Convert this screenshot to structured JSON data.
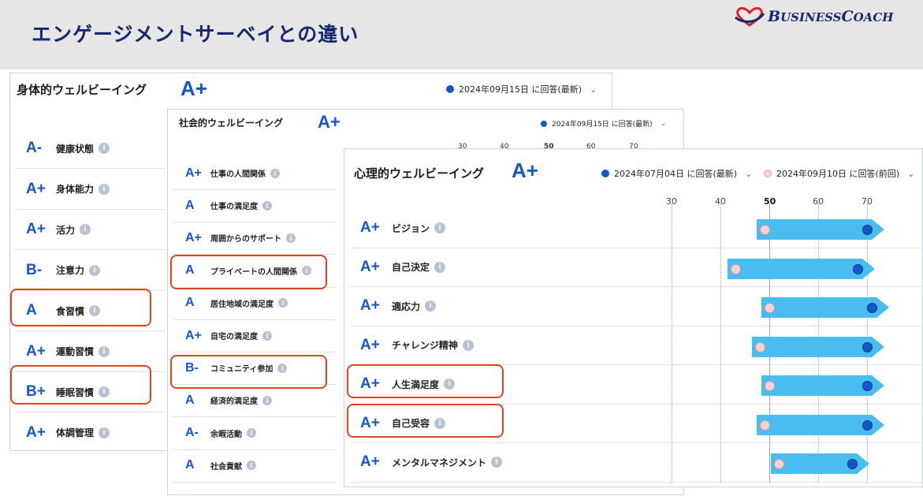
{
  "slide": {
    "title": "エンゲージメントサーベイとの違い",
    "logo_text_b": "B",
    "logo_text_rest1": "USINESS",
    "logo_text_c": "C",
    "logo_text_rest2": "OACH"
  },
  "physical": {
    "title": "身体的ウェルビーイング",
    "overall_grade": "A+",
    "selector": "2024年09月15日 に回答(最新)",
    "items": [
      {
        "grade": "A-",
        "label": "健康状態"
      },
      {
        "grade": "A+",
        "label": "身体能力"
      },
      {
        "grade": "A+",
        "label": "活力"
      },
      {
        "grade": "B-",
        "label": "注意力"
      },
      {
        "grade": "A",
        "label": "食習慣"
      },
      {
        "grade": "A+",
        "label": "運動習慣"
      },
      {
        "grade": "B+",
        "label": "睡眠習慣"
      },
      {
        "grade": "A+",
        "label": "体調管理"
      }
    ]
  },
  "social": {
    "title": "社会的ウェルビーイング",
    "overall_grade": "A+",
    "selector": "2024年09月15日 に回答(最新)",
    "axis": [
      "30",
      "40",
      "50",
      "60",
      "70"
    ],
    "items": [
      {
        "grade": "A+",
        "label": "仕事の人間関係"
      },
      {
        "grade": "A",
        "label": "仕事の満足度"
      },
      {
        "grade": "A+",
        "label": "周囲からのサポート"
      },
      {
        "grade": "A",
        "label": "プライベートの人間関係"
      },
      {
        "grade": "A",
        "label": "居住地域の満足度"
      },
      {
        "grade": "A+",
        "label": "自宅の満足度"
      },
      {
        "grade": "B-",
        "label": "コミュニティ参加"
      },
      {
        "grade": "A",
        "label": "経済的満足度"
      },
      {
        "grade": "A-",
        "label": "余暇活動"
      },
      {
        "grade": "A",
        "label": "社会貢献"
      }
    ]
  },
  "psychological": {
    "title": "心理的ウェルビーイング",
    "overall_grade": "A+",
    "selector_latest": "2024年07月04日 に回答(最新)",
    "selector_previous": "2024年09月10日 に回答(前回)",
    "axis": [
      "30",
      "40",
      "50",
      "60",
      "70"
    ],
    "items": [
      {
        "grade": "A+",
        "label": "ビジョン",
        "previous": 49,
        "latest": 70
      },
      {
        "grade": "A+",
        "label": "自己決定",
        "previous": 43,
        "latest": 68
      },
      {
        "grade": "A+",
        "label": "適応力",
        "previous": 50,
        "latest": 71
      },
      {
        "grade": "A+",
        "label": "チャレンジ精神",
        "previous": 48,
        "latest": 70
      },
      {
        "grade": "A+",
        "label": "人生満足度",
        "previous": 50,
        "latest": 70
      },
      {
        "grade": "A+",
        "label": "自己受容",
        "previous": 49,
        "latest": 70
      },
      {
        "grade": "A+",
        "label": "メンタルマネジメント",
        "previous": 52,
        "latest": 67
      }
    ]
  },
  "colors": {
    "grade": "#1556c9",
    "bar": "#49bdf0",
    "highlight": "#e0431f",
    "title": "#17276e"
  }
}
